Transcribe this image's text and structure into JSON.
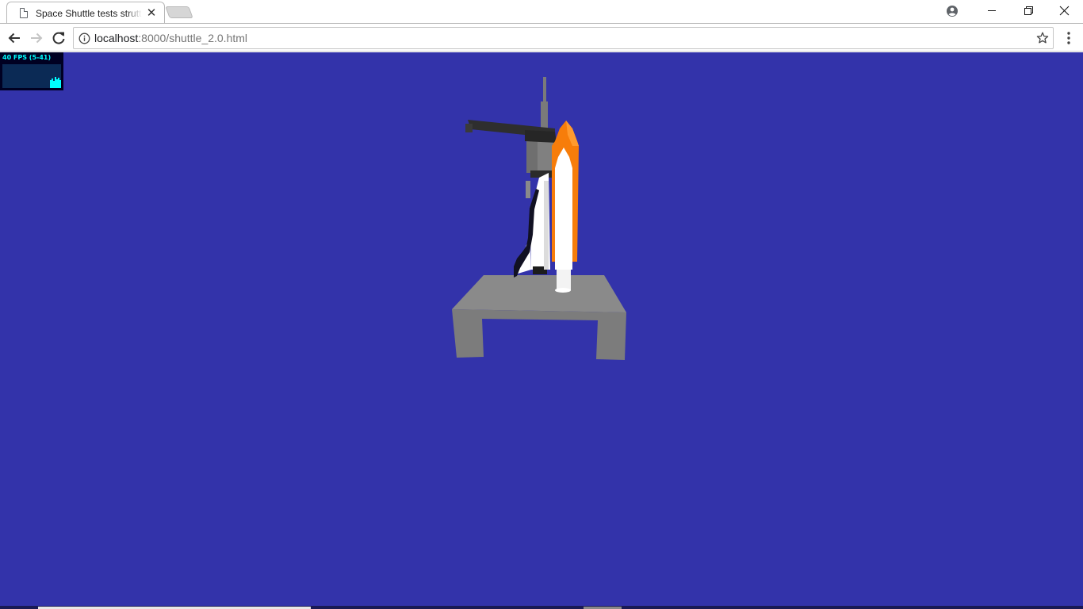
{
  "tab": {
    "title": "Space Shuttle tests strutt",
    "close_symbol": "✕"
  },
  "address_bar": {
    "host": "localhost",
    "rest": ":8000/shuttle_2.0.html"
  },
  "window_controls": {
    "minimize": "—",
    "maximize": "❐",
    "close": "✕"
  },
  "stats": {
    "fps_text": "40 FPS (5-41)"
  },
  "colors": {
    "background": "#3333aa",
    "launch_pad": "#888888",
    "tower": "#808080",
    "tower_arm": "#2e2e2e",
    "external_tank": "#f77d0a",
    "orbiter": "#ffffff",
    "stats_text": "#00ffff"
  },
  "icons": {
    "tab_page": "page-icon",
    "new_tab": "new-tab-icon",
    "profile": "account-circle-icon",
    "back": "arrow-left-icon",
    "forward": "arrow-right-icon",
    "reload": "reload-icon",
    "site_info": "info-icon",
    "bookmark": "star-icon",
    "menu": "more-vert-icon"
  }
}
